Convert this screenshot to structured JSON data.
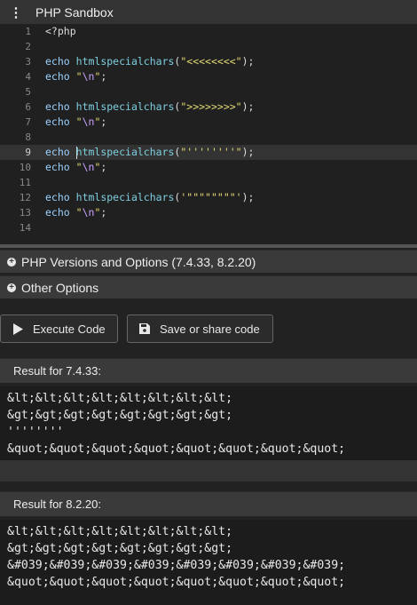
{
  "app": {
    "title": "PHP Sandbox"
  },
  "editor": {
    "lines": [
      {
        "n": "1",
        "tokens": [
          {
            "t": "<?php",
            "c": ""
          }
        ]
      },
      {
        "n": "2",
        "tokens": []
      },
      {
        "n": "3",
        "tokens": [
          {
            "t": "echo",
            "c": "kw"
          },
          {
            "t": " ",
            "c": ""
          },
          {
            "t": "htmlspecialchars",
            "c": "fn"
          },
          {
            "t": "(",
            "c": ""
          },
          {
            "t": "\"<<<<<<<<\"",
            "c": "str"
          },
          {
            "t": ");",
            "c": ""
          }
        ]
      },
      {
        "n": "4",
        "tokens": [
          {
            "t": "echo",
            "c": "kw"
          },
          {
            "t": " ",
            "c": ""
          },
          {
            "t": "\"",
            "c": "str"
          },
          {
            "t": "\\n",
            "c": "esc"
          },
          {
            "t": "\"",
            "c": "str"
          },
          {
            "t": ";",
            "c": ""
          }
        ]
      },
      {
        "n": "5",
        "tokens": []
      },
      {
        "n": "6",
        "tokens": [
          {
            "t": "echo",
            "c": "kw"
          },
          {
            "t": " ",
            "c": ""
          },
          {
            "t": "htmlspecialchars",
            "c": "fn"
          },
          {
            "t": "(",
            "c": ""
          },
          {
            "t": "\">>>>>>>>\"",
            "c": "str"
          },
          {
            "t": ");",
            "c": ""
          }
        ]
      },
      {
        "n": "7",
        "tokens": [
          {
            "t": "echo",
            "c": "kw"
          },
          {
            "t": " ",
            "c": ""
          },
          {
            "t": "\"",
            "c": "str"
          },
          {
            "t": "\\n",
            "c": "esc"
          },
          {
            "t": "\"",
            "c": "str"
          },
          {
            "t": ";",
            "c": ""
          }
        ]
      },
      {
        "n": "8",
        "tokens": []
      },
      {
        "n": "9",
        "active": true,
        "tokens": [
          {
            "t": "echo",
            "c": "kw"
          },
          {
            "t": " ",
            "c": ""
          },
          {
            "t": "|",
            "c": "cursor"
          },
          {
            "t": "htmlspecialchars",
            "c": "fn"
          },
          {
            "t": "(",
            "c": ""
          },
          {
            "t": "\"''''''''\"",
            "c": "str"
          },
          {
            "t": ");",
            "c": ""
          }
        ]
      },
      {
        "n": "10",
        "tokens": [
          {
            "t": "echo",
            "c": "kw"
          },
          {
            "t": " ",
            "c": ""
          },
          {
            "t": "\"",
            "c": "str"
          },
          {
            "t": "\\n",
            "c": "esc"
          },
          {
            "t": "\"",
            "c": "str"
          },
          {
            "t": ";",
            "c": ""
          }
        ]
      },
      {
        "n": "11",
        "tokens": []
      },
      {
        "n": "12",
        "tokens": [
          {
            "t": "echo",
            "c": "kw"
          },
          {
            "t": " ",
            "c": ""
          },
          {
            "t": "htmlspecialchars",
            "c": "fn"
          },
          {
            "t": "(",
            "c": ""
          },
          {
            "t": "'\"\"\"\"\"\"\"\"'",
            "c": "str"
          },
          {
            "t": ");",
            "c": ""
          }
        ]
      },
      {
        "n": "13",
        "tokens": [
          {
            "t": "echo",
            "c": "kw"
          },
          {
            "t": " ",
            "c": ""
          },
          {
            "t": "\"",
            "c": "str"
          },
          {
            "t": "\\n",
            "c": "esc"
          },
          {
            "t": "\"",
            "c": "str"
          },
          {
            "t": ";",
            "c": ""
          }
        ]
      },
      {
        "n": "14",
        "tokens": []
      }
    ]
  },
  "sections": {
    "versions": "PHP Versions and Options (7.4.33, 8.2.20)",
    "other": "Other Options"
  },
  "buttons": {
    "execute": "Execute Code",
    "save": "Save or share code"
  },
  "results": [
    {
      "title": "Result for 7.4.33:",
      "lines": [
        "&lt;&lt;&lt;&lt;&lt;&lt;&lt;&lt;",
        "&gt;&gt;&gt;&gt;&gt;&gt;&gt;&gt;",
        "''''''''",
        "&quot;&quot;&quot;&quot;&quot;&quot;&quot;&quot;"
      ]
    },
    {
      "title": "Result for 8.2.20:",
      "lines": [
        "&lt;&lt;&lt;&lt;&lt;&lt;&lt;&lt;",
        "&gt;&gt;&gt;&gt;&gt;&gt;&gt;&gt;",
        "&#039;&#039;&#039;&#039;&#039;&#039;&#039;&#039;",
        "&quot;&quot;&quot;&quot;&quot;&quot;&quot;&quot;"
      ]
    }
  ],
  "colors": {
    "background": "#222222",
    "panel": "#3a3a3a",
    "string": "#e6db74",
    "keyword": "#9ad1ff"
  },
  "icons": {
    "menu": "vertical-dots-icon",
    "expand": "plus-circle-icon",
    "execute": "play-icon",
    "save": "floppy-disk-icon"
  }
}
